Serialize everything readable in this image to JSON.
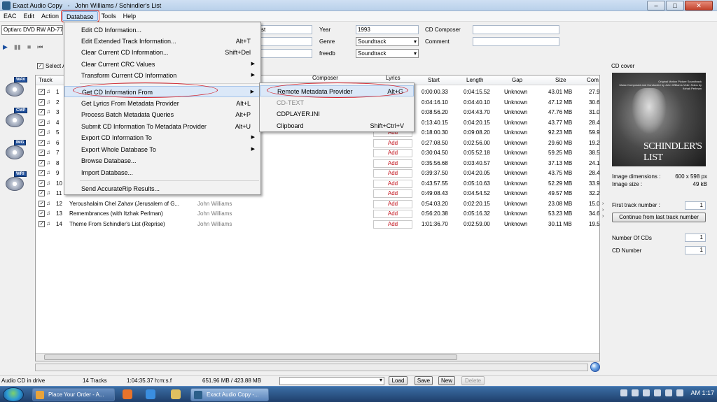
{
  "window": {
    "title": "Exact Audio Copy   -   John Williams / Schindler's List",
    "minimize": "–",
    "maximize": "□",
    "close": "✕"
  },
  "menubar": [
    "EAC",
    "Edit",
    "Action",
    "Database",
    "Tools",
    "Help"
  ],
  "drive": "Optiarc DVD RW AD-77",
  "transport": [
    "▶",
    "▮▮",
    "■",
    "⏮"
  ],
  "fields": {
    "artist_value": "st",
    "year_label": "Year",
    "year_value": "1993",
    "genre_label": "Genre",
    "genre_value": "Soundtrack",
    "freedb_label": "freedb",
    "freedb_value": "Soundtrack",
    "composer_label": "CD Composer",
    "comment_label": "Comment"
  },
  "side_icons": [
    "WAV",
    "CMP",
    "IMG",
    "WRI"
  ],
  "select_all": "Select A",
  "columns": [
    "Track",
    "Composer",
    "Lyrics",
    "Start",
    "Length",
    "Gap",
    "Size",
    "Com"
  ],
  "rows": [
    {
      "n": "1",
      "title": "",
      "artist": "",
      "lyrics": "",
      "start": "0:00:00.33",
      "length": "0:04:15.52",
      "gap": "Unknown",
      "size": "43.01 MB",
      "com": "27.9"
    },
    {
      "n": "2",
      "title": "",
      "artist": "",
      "lyrics": "",
      "start": "0:04:16.10",
      "length": "0:04:40.10",
      "gap": "Unknown",
      "size": "47.12 MB",
      "com": "30.6"
    },
    {
      "n": "3",
      "title": "",
      "artist": "",
      "lyrics": "",
      "start": "0:08:56.20",
      "length": "0:04:43.70",
      "gap": "Unknown",
      "size": "47.76 MB",
      "com": "31.0"
    },
    {
      "n": "4",
      "title": "",
      "artist": "",
      "lyrics": "",
      "start": "0:13:40.15",
      "length": "0:04:20.15",
      "gap": "Unknown",
      "size": "43.77 MB",
      "com": "28.4"
    },
    {
      "n": "5",
      "title": "",
      "artist": "",
      "lyrics": "Add",
      "start": "0:18:00.30",
      "length": "0:09:08.20",
      "gap": "Unknown",
      "size": "92.23 MB",
      "com": "59.9"
    },
    {
      "n": "6",
      "title": "",
      "artist": "",
      "lyrics": "Add",
      "start": "0:27:08.50",
      "length": "0:02:56.00",
      "gap": "Unknown",
      "size": "29.60 MB",
      "com": "19.2"
    },
    {
      "n": "7",
      "title": "",
      "artist": "",
      "lyrics": "Add",
      "start": "0:30:04.50",
      "length": "0:05:52.18",
      "gap": "Unknown",
      "size": "59.25 MB",
      "com": "38.5"
    },
    {
      "n": "8",
      "title": "",
      "artist": "",
      "lyrics": "Add",
      "start": "0:35:56.68",
      "length": "0:03:40.57",
      "gap": "Unknown",
      "size": "37.13 MB",
      "com": "24.1"
    },
    {
      "n": "9",
      "title": "",
      "artist": "",
      "lyrics": "Add",
      "start": "0:39:37.50",
      "length": "0:04:20.05",
      "gap": "Unknown",
      "size": "43.75 MB",
      "com": "28.4"
    },
    {
      "n": "10",
      "title": "",
      "artist": "",
      "lyrics": "Add",
      "start": "0:43:57.55",
      "length": "0:05:10.63",
      "gap": "Unknown",
      "size": "52.29 MB",
      "com": "33.9"
    },
    {
      "n": "11",
      "title": "",
      "artist": "",
      "lyrics": "Add",
      "start": "0:49:08.43",
      "length": "0:04:54.52",
      "gap": "Unknown",
      "size": "49.57 MB",
      "com": "32.2"
    },
    {
      "n": "12",
      "title": "Yeroushalaim Chel Zahav (Jerusalem of G...",
      "artist": "John Williams",
      "lyrics": "Add",
      "start": "0:54:03.20",
      "length": "0:02:20.15",
      "gap": "Unknown",
      "size": "23.08 MB",
      "com": "15.0"
    },
    {
      "n": "13",
      "title": "Remembrances (with Itzhak Perlman)",
      "artist": "John Williams",
      "lyrics": "Add",
      "start": "0:56:20.38",
      "length": "0:05:16.32",
      "gap": "Unknown",
      "size": "53.23 MB",
      "com": "34.6"
    },
    {
      "n": "14",
      "title": "Theme From Schindler's List (Reprise)",
      "artist": "John Williams",
      "lyrics": "Add",
      "start": "1:01:36.70",
      "length": "0:02:59.00",
      "gap": "Unknown",
      "size": "30.11 MB",
      "com": "19.5"
    }
  ],
  "database_menu": [
    {
      "label": "Edit CD Information...",
      "shortcut": "",
      "arrow": false
    },
    {
      "label": "Edit Extended Track Information...",
      "shortcut": "Alt+T",
      "arrow": false
    },
    {
      "label": "Clear Current CD Information...",
      "shortcut": "Shift+Del",
      "arrow": false
    },
    {
      "label": "Clear Current CRC Values",
      "shortcut": "",
      "arrow": true
    },
    {
      "label": "Transform Current CD Information",
      "shortcut": "",
      "arrow": true
    },
    {
      "label": "Get CD Information From",
      "shortcut": "",
      "arrow": true
    },
    {
      "label": "Get Lyrics From Metadata Provider",
      "shortcut": "Alt+L",
      "arrow": false
    },
    {
      "label": "Process Batch Metadata Queries",
      "shortcut": "Alt+P",
      "arrow": false
    },
    {
      "label": "Submit CD Information To Metadata Provider",
      "shortcut": "Alt+U",
      "arrow": false
    },
    {
      "label": "Export CD Information To",
      "shortcut": "",
      "arrow": true
    },
    {
      "label": "Export Whole Database To",
      "shortcut": "",
      "arrow": true
    },
    {
      "label": "Browse Database...",
      "shortcut": "",
      "arrow": false
    },
    {
      "label": "Import Database...",
      "shortcut": "",
      "arrow": false
    },
    {
      "label": "Send AccurateRip Results...",
      "shortcut": "",
      "arrow": false
    }
  ],
  "submenu": [
    {
      "label": "Remote Metadata Provider",
      "shortcut": "Alt+G",
      "disabled": false
    },
    {
      "label": "CD-TEXT",
      "shortcut": "",
      "disabled": true
    },
    {
      "label": "CDPLAYER.INI",
      "shortcut": "",
      "disabled": false
    },
    {
      "label": "Clipboard",
      "shortcut": "Shift+Ctrl+V",
      "disabled": false
    }
  ],
  "cover": {
    "label": "CD cover",
    "art_title": "SCHINDLER'S LIST",
    "art_small": "Original Motion Picture Soundtrack",
    "art_credit": "Music Composed and Conducted by John Williams Violin Solos by Itzhak Perlman",
    "dims_label": "Image dimensions :",
    "dims_value": "600 x 598 px",
    "size_label": "Image size :",
    "size_value": "49 kB"
  },
  "right_panel": {
    "first_track_label": "First track number :",
    "first_track_value": "1",
    "continue_button": "Continue from last track number",
    "num_cds_label": "Number Of CDs",
    "num_cds_value": "1",
    "cd_number_label": "CD Number",
    "cd_number_value": "1"
  },
  "status": {
    "drive": "Audio CD in drive",
    "tracks": "14 Tracks",
    "duration": "1:04:35.37 h:m:s.f",
    "size": "651.96 MB / 423.88 MB",
    "load": "Load",
    "save": "Save",
    "new": "New",
    "delete": "Delete"
  },
  "taskbar": {
    "task1": "Place Your Order - A...",
    "task2": "Exact Audio Copy   -...",
    "clock": "AM 1:17"
  }
}
